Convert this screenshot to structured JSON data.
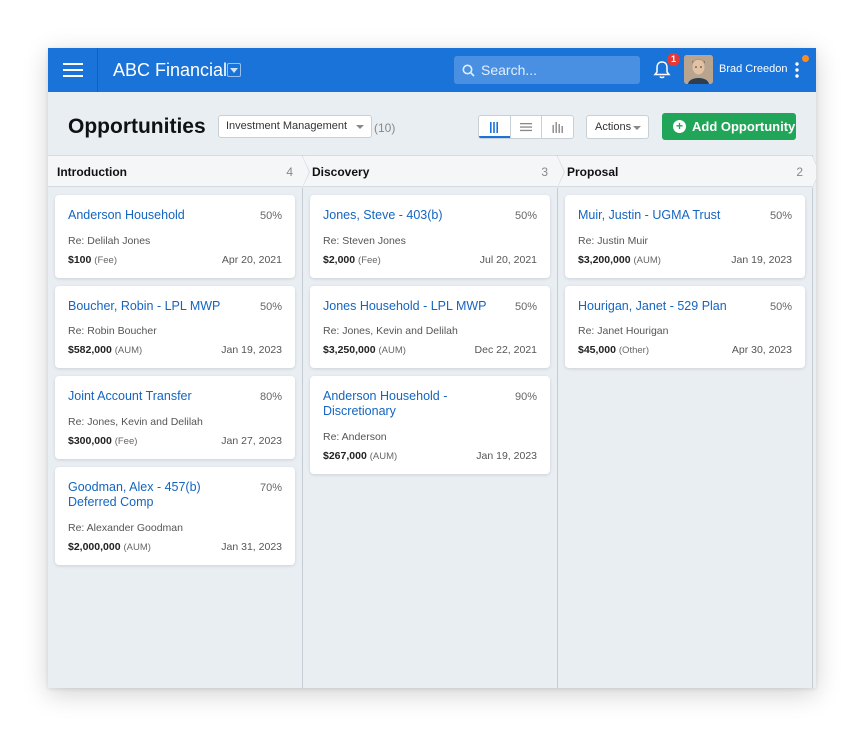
{
  "app": {
    "title": "ABC Financial",
    "search_placeholder": "Search...",
    "notification_count": "1",
    "user_name": "Brad Creedon",
    "accent": "#1a73d9",
    "success": "#21a558"
  },
  "header": {
    "title": "Opportunities",
    "filter": "Investment Management",
    "count": "(10)",
    "actions_label": "Actions",
    "add_label": "Add Opportunity"
  },
  "columns": [
    {
      "name": "Introduction",
      "count": "4",
      "cards": [
        {
          "title": "Anderson Household",
          "pct": "50%",
          "re": "Re: Delilah Jones",
          "amount": "$100",
          "type": "(Fee)",
          "date": "Apr 20, 2021"
        },
        {
          "title": "Boucher, Robin - LPL MWP",
          "pct": "50%",
          "re": "Re: Robin Boucher",
          "amount": "$582,000",
          "type": "(AUM)",
          "date": "Jan 19, 2023"
        },
        {
          "title": "Joint Account Transfer",
          "pct": "80%",
          "re": "Re: Jones, Kevin and Delilah",
          "amount": "$300,000",
          "type": "(Fee)",
          "date": "Jan 27, 2023"
        },
        {
          "title": "Goodman, Alex - 457(b) Deferred Comp",
          "pct": "70%",
          "re": "Re: Alexander Goodman",
          "amount": "$2,000,000",
          "type": "(AUM)",
          "date": "Jan 31, 2023"
        }
      ]
    },
    {
      "name": "Discovery",
      "count": "3",
      "cards": [
        {
          "title": "Jones, Steve - 403(b)",
          "pct": "50%",
          "re": "Re: Steven Jones",
          "amount": "$2,000",
          "type": "(Fee)",
          "date": "Jul 20, 2021"
        },
        {
          "title": "Jones Household - LPL MWP",
          "pct": "50%",
          "re": "Re: Jones, Kevin and Delilah",
          "amount": "$3,250,000",
          "type": "(AUM)",
          "date": "Dec 22, 2021"
        },
        {
          "title": "Anderson Household - Discretionary",
          "pct": "90%",
          "re": "Re: Anderson",
          "amount": "$267,000",
          "type": "(AUM)",
          "date": "Jan 19, 2023"
        }
      ]
    },
    {
      "name": "Proposal",
      "count": "2",
      "cards": [
        {
          "title": "Muir, Justin - UGMA Trust",
          "pct": "50%",
          "re": "Re: Justin Muir",
          "amount": "$3,200,000",
          "type": "(AUM)",
          "date": "Jan 19, 2023"
        },
        {
          "title": "Hourigan, Janet - 529 Plan",
          "pct": "50%",
          "re": "Re: Janet Hourigan",
          "amount": "$45,000",
          "type": "(Other)",
          "date": "Apr 30, 2023"
        }
      ]
    }
  ]
}
